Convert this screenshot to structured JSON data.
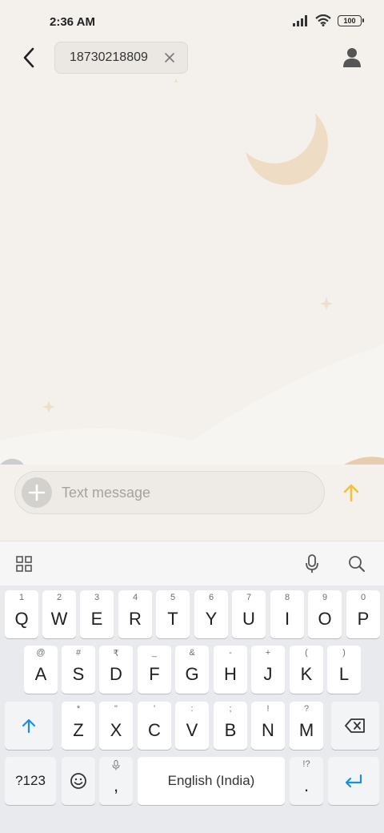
{
  "status": {
    "time": "2:36 AM",
    "battery": "100"
  },
  "header": {
    "recipient": "18730218809"
  },
  "composer": {
    "placeholder": "Text message"
  },
  "keyboard": {
    "row1": [
      {
        "hint": "1",
        "label": "Q"
      },
      {
        "hint": "2",
        "label": "W"
      },
      {
        "hint": "3",
        "label": "E"
      },
      {
        "hint": "4",
        "label": "R"
      },
      {
        "hint": "5",
        "label": "T"
      },
      {
        "hint": "6",
        "label": "Y"
      },
      {
        "hint": "7",
        "label": "U"
      },
      {
        "hint": "8",
        "label": "I"
      },
      {
        "hint": "9",
        "label": "O"
      },
      {
        "hint": "0",
        "label": "P"
      }
    ],
    "row2": [
      {
        "hint": "@",
        "label": "A"
      },
      {
        "hint": "#",
        "label": "S"
      },
      {
        "hint": "₹",
        "label": "D"
      },
      {
        "hint": "_",
        "label": "F"
      },
      {
        "hint": "&",
        "label": "G"
      },
      {
        "hint": "-",
        "label": "H"
      },
      {
        "hint": "+",
        "label": "J"
      },
      {
        "hint": "(",
        "label": "K"
      },
      {
        "hint": ")",
        "label": "L"
      }
    ],
    "row3": [
      {
        "hint": "*",
        "label": "Z"
      },
      {
        "hint": "\"",
        "label": "X"
      },
      {
        "hint": "'",
        "label": "C"
      },
      {
        "hint": ":",
        "label": "V"
      },
      {
        "hint": ";",
        "label": "B"
      },
      {
        "hint": "!",
        "label": "N"
      },
      {
        "hint": "?",
        "label": "M"
      }
    ],
    "symbols_label": "?123",
    "comma_label": ",",
    "space_label": "English (India)",
    "period_hint": "!?",
    "period_label": "."
  }
}
